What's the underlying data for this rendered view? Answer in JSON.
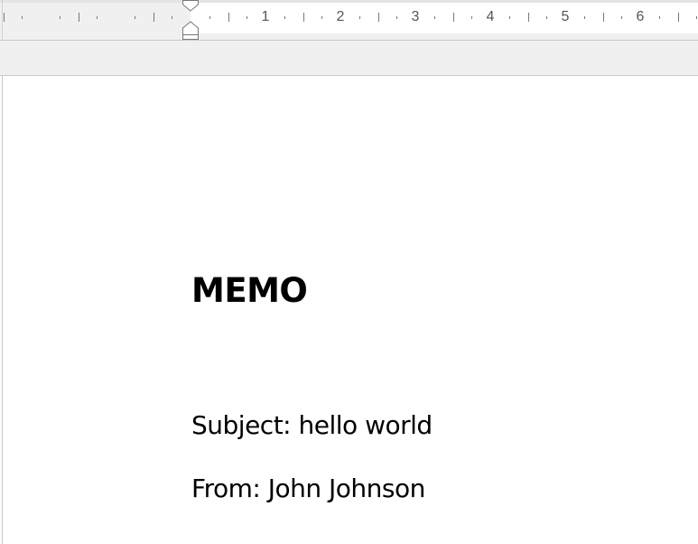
{
  "ruler": {
    "numbers": [
      "1",
      "2",
      "3",
      "4",
      "5",
      "6"
    ]
  },
  "document": {
    "title": "MEMO",
    "subject_line": "Subject: hello world",
    "from_line": "From: John Johnson"
  }
}
